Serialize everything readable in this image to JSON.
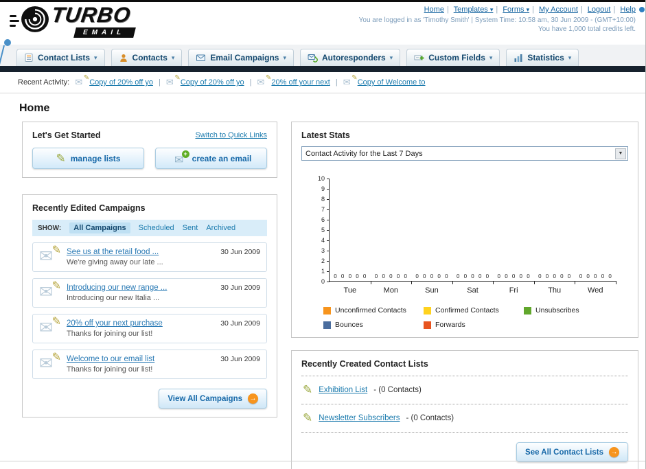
{
  "icons": {
    "caret_down": "▾",
    "select_arrow": "▼",
    "envelope": "✉",
    "pencil": "✎",
    "plus": "+",
    "arrow_right": "→"
  },
  "colors": {
    "link_teal": "#1a7aad",
    "orange": "#f7941d",
    "dark_bar": "#16212d"
  },
  "header": {
    "logo_title": "TURBO",
    "logo_subtitle": "EMAIL",
    "links": [
      "Home",
      "Templates",
      "Forms",
      "My Account",
      "Logout",
      "Help"
    ],
    "session_line": "You are logged in as 'Timothy Smith' | System Time: 10:58 am, 30 Jun 2009 - (GMT+10:00)",
    "credits_line": "You have 1,000 total credits left."
  },
  "nav": {
    "tabs": [
      {
        "label": "Contact Lists"
      },
      {
        "label": "Contacts"
      },
      {
        "label": "Email Campaigns"
      },
      {
        "label": "Autoresponders"
      },
      {
        "label": "Custom Fields"
      },
      {
        "label": "Statistics"
      }
    ]
  },
  "recent_activity": {
    "label": "Recent Activity:",
    "items": [
      {
        "label": "Copy of 20% off yo"
      },
      {
        "label": "Copy of 20% off yo"
      },
      {
        "label": "20% off your next"
      },
      {
        "label": "Copy of Welcome to"
      }
    ]
  },
  "page": {
    "title": "Home"
  },
  "get_started": {
    "title": "Let's Get Started",
    "switch_link": "Switch to Quick Links",
    "manage_lists_label": "manage lists",
    "create_email_label": "create an email"
  },
  "campaigns": {
    "title": "Recently Edited Campaigns",
    "show_label": "SHOW:",
    "filters": [
      {
        "label": "All Campaigns",
        "active": true
      },
      {
        "label": "Scheduled",
        "active": false
      },
      {
        "label": "Sent",
        "active": false
      },
      {
        "label": "Archived",
        "active": false
      }
    ],
    "items": [
      {
        "title": "See us at the retail food ...",
        "subtitle": "We're giving away our late ...",
        "date": "30 Jun 2009"
      },
      {
        "title": "Introducing our new range ...",
        "subtitle": "Introducing our new Italia ...",
        "date": "30 Jun 2009"
      },
      {
        "title": "20% off your next purchase",
        "subtitle": "Thanks for joining our list!",
        "date": "30 Jun 2009"
      },
      {
        "title": "Welcome to our email list",
        "subtitle": "Thanks for joining our list!",
        "date": "30 Jun 2009"
      }
    ],
    "view_all_label": "View All Campaigns"
  },
  "stats": {
    "title": "Latest Stats",
    "dropdown_value": "Contact Activity for the Last 7 Days",
    "chart_data": {
      "type": "bar",
      "title": "Contact Activity for the Last 7 Days",
      "categories": [
        "Tue",
        "Mon",
        "Sun",
        "Sat",
        "Fri",
        "Thu",
        "Wed"
      ],
      "series": [
        {
          "name": "Unconfirmed Contacts",
          "color": "#f7941d",
          "values": [
            0,
            0,
            0,
            0,
            0,
            0,
            0
          ]
        },
        {
          "name": "Confirmed Contacts",
          "color": "#ffd21e",
          "values": [
            0,
            0,
            0,
            0,
            0,
            0,
            0
          ]
        },
        {
          "name": "Unsubscribes",
          "color": "#61a72c",
          "values": [
            0,
            0,
            0,
            0,
            0,
            0,
            0
          ]
        },
        {
          "name": "Bounces",
          "color": "#4a6d9e",
          "values": [
            0,
            0,
            0,
            0,
            0,
            0,
            0
          ]
        },
        {
          "name": "Forwards",
          "color": "#e8541f",
          "values": [
            0,
            0,
            0,
            0,
            0,
            0,
            0
          ]
        }
      ],
      "xlabel": "",
      "ylabel": "",
      "ylim": [
        0,
        10
      ],
      "yticks": [
        0,
        1,
        2,
        3,
        4,
        5,
        6,
        7,
        8,
        9,
        10
      ],
      "grid": false,
      "legend_position": "bottom"
    }
  },
  "contact_lists": {
    "title": "Recently Created Contact Lists",
    "items": [
      {
        "name": "Exhibition List",
        "detail": "- (0 Contacts)"
      },
      {
        "name": "Newsletter Subscribers",
        "detail": "- (0 Contacts)"
      }
    ],
    "see_all_label": "See All Contact Lists"
  }
}
